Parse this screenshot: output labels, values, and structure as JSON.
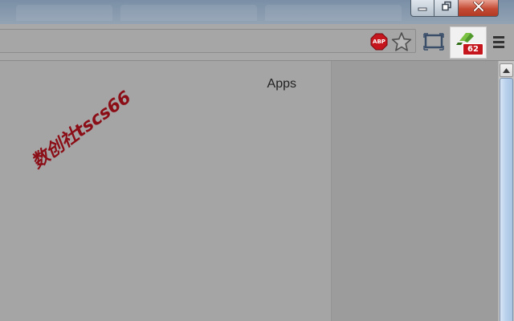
{
  "window": {
    "controls": [
      "minimize-icon",
      "restore-icon",
      "close-icon"
    ]
  },
  "toolbar": {
    "adblock_label": "ABP",
    "extension_badge": "62",
    "icons": [
      "adblock-icon",
      "star-icon",
      "cast-icon",
      "extension-icon",
      "menu-icon"
    ]
  },
  "content": {
    "apps_label": "Apps",
    "watermark": "数创社tscs66"
  },
  "colors": {
    "close_button": "#c44a34",
    "badge": "#c4161c",
    "adblock": "#c4161c",
    "watermark": "#8b0d16",
    "scroll_thumb": "#b9d1ec"
  }
}
